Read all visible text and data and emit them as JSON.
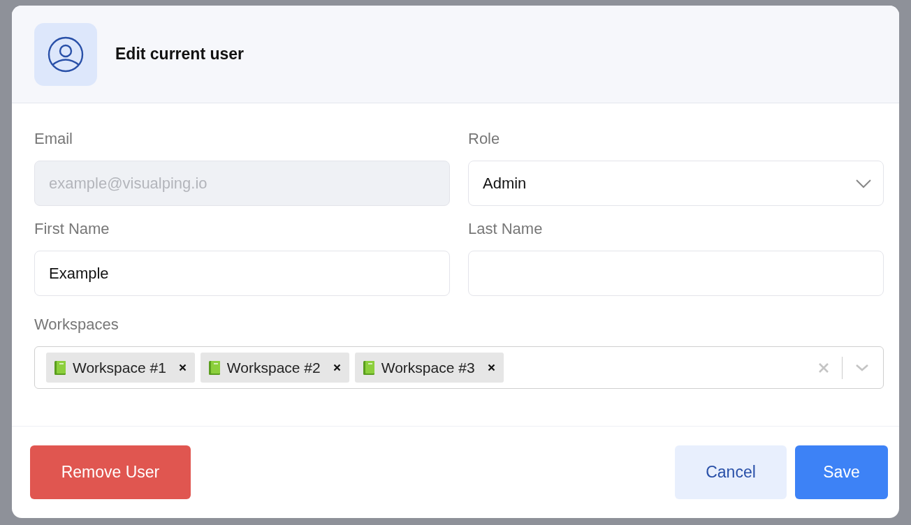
{
  "dialog": {
    "title": "Edit current user"
  },
  "fields": [
    {
      "label": "Email",
      "kind": "text",
      "placeholder": "example@visualping.io",
      "disabled": true
    },
    {
      "label": "Role",
      "kind": "select",
      "value": "Admin",
      "disabled": false
    },
    {
      "label": "First Name",
      "kind": "text",
      "value": "Example",
      "disabled": false
    },
    {
      "label": "Last Name",
      "kind": "text",
      "disabled": false
    }
  ],
  "workspaces": {
    "label": "Workspaces",
    "tags": [
      {
        "label": "Workspace #1"
      },
      {
        "label": "Workspace #2"
      },
      {
        "label": "Workspace #3"
      }
    ]
  },
  "buttons": [
    {
      "label": "Remove User",
      "kind": "danger"
    },
    {
      "label": "Cancel",
      "kind": "secondary"
    },
    {
      "label": "Save",
      "kind": "primary"
    }
  ]
}
